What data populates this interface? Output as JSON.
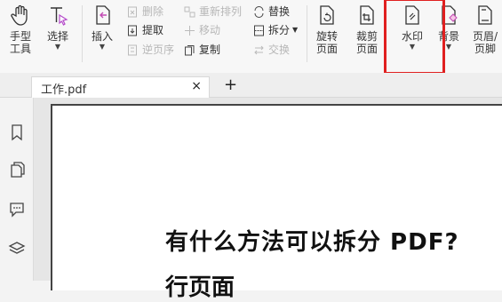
{
  "toolbar": {
    "hand_tool_label": "手型\n工具",
    "select_label": "选择",
    "insert_label": "插入",
    "delete_label": "删除",
    "extract_label": "提取",
    "reverse_label": "逆页序",
    "reorder_label": "重新排列",
    "move_label": "移动",
    "copy_label": "复制",
    "replace_label": "替换",
    "split_label": "拆分",
    "swap_label": "交换",
    "rotate_label": "旋转\n页面",
    "crop_label": "裁剪\n页面",
    "watermark_label": "水印",
    "background_label": "背景",
    "header_footer_label": "页眉/\n页脚"
  },
  "tabs": {
    "active_label": "工作.pdf",
    "close_symbol": "×",
    "new_tab_symbol": "+"
  },
  "document": {
    "heading_line1": "有什么方法可以拆分 PDF?",
    "heading_line2": "行页面"
  },
  "colors": {
    "highlight": "#e02020",
    "select_accent": "#b44ac9",
    "insert_accent": "#c24ab3"
  },
  "icons": {
    "hand": "hand-icon",
    "select": "text-cursor-icon",
    "insert": "insert-page-icon",
    "watermark": "watermark-icon"
  }
}
